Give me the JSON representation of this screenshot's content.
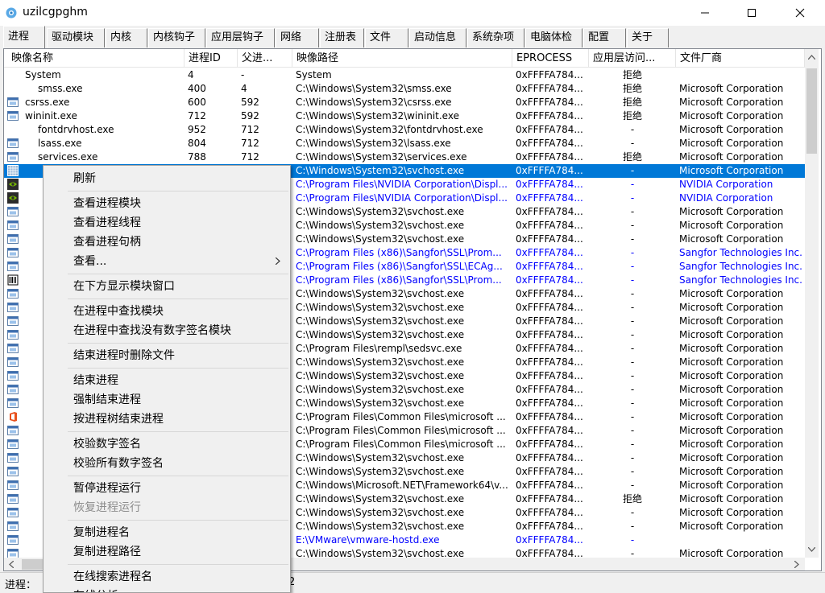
{
  "window": {
    "title": "uzilcgpghm"
  },
  "tabs": [
    "进程",
    "驱动模块",
    "内核",
    "内核钩子",
    "应用层钩子",
    "网络",
    "注册表",
    "文件",
    "启动信息",
    "系统杂项",
    "电脑体检",
    "配置",
    "关于"
  ],
  "columns": [
    "映像名称",
    "进程ID",
    "父进...",
    "映像路径",
    "EPROCESS",
    "应用层访问...",
    "文件厂商"
  ],
  "rows": [
    {
      "name": "System",
      "pid": "4",
      "ppid": "-",
      "path": "System",
      "eprocess": "0xFFFFA784...",
      "access": "拒绝",
      "vendor": "",
      "icon": "none",
      "indent": 1,
      "blue": false,
      "sel": false
    },
    {
      "name": "smss.exe",
      "pid": "400",
      "ppid": "4",
      "path": "C:\\Windows\\System32\\smss.exe",
      "eprocess": "0xFFFFA784...",
      "access": "拒绝",
      "vendor": "Microsoft Corporation",
      "icon": "none",
      "indent": 2,
      "blue": false,
      "sel": false
    },
    {
      "name": "csrss.exe",
      "pid": "600",
      "ppid": "592",
      "path": "C:\\Windows\\System32\\csrss.exe",
      "eprocess": "0xFFFFA784...",
      "access": "拒绝",
      "vendor": "Microsoft Corporation",
      "icon": "win",
      "indent": 0,
      "blue": false,
      "sel": false
    },
    {
      "name": "wininit.exe",
      "pid": "712",
      "ppid": "592",
      "path": "C:\\Windows\\System32\\wininit.exe",
      "eprocess": "0xFFFFA784...",
      "access": "拒绝",
      "vendor": "Microsoft Corporation",
      "icon": "win",
      "indent": 0,
      "blue": false,
      "sel": false
    },
    {
      "name": "fontdrvhost.exe",
      "pid": "952",
      "ppid": "712",
      "path": "C:\\Windows\\System32\\fontdrvhost.exe",
      "eprocess": "0xFFFFA784...",
      "access": "-",
      "vendor": "Microsoft Corporation",
      "icon": "none",
      "indent": 2,
      "blue": false,
      "sel": false
    },
    {
      "name": "lsass.exe",
      "pid": "804",
      "ppid": "712",
      "path": "C:\\Windows\\System32\\lsass.exe",
      "eprocess": "0xFFFFA784...",
      "access": "-",
      "vendor": "Microsoft Corporation",
      "icon": "win",
      "indent": 2,
      "blue": false,
      "sel": false
    },
    {
      "name": "services.exe",
      "pid": "788",
      "ppid": "712",
      "path": "C:\\Windows\\System32\\services.exe",
      "eprocess": "0xFFFFA784...",
      "access": "拒绝",
      "vendor": "Microsoft Corporation",
      "icon": "win",
      "indent": 2,
      "blue": false,
      "sel": false
    },
    {
      "name": "",
      "pid": "",
      "ppid": "",
      "path": "C:\\Windows\\System32\\svchost.exe",
      "eprocess": "0xFFFFA784...",
      "access": "-",
      "vendor": "Microsoft Corporation",
      "icon": "grid",
      "indent": 0,
      "blue": false,
      "sel": true
    },
    {
      "name": "",
      "pid": "",
      "ppid": "",
      "path": "C:\\Program Files\\NVIDIA Corporation\\Displ...",
      "eprocess": "0xFFFFA784...",
      "access": "-",
      "vendor": "NVIDIA Corporation",
      "icon": "nvidia",
      "indent": 0,
      "blue": true,
      "sel": false
    },
    {
      "name": "",
      "pid": "",
      "ppid": "",
      "path": "C:\\Program Files\\NVIDIA Corporation\\Displ...",
      "eprocess": "0xFFFFA784...",
      "access": "-",
      "vendor": "NVIDIA Corporation",
      "icon": "nvidia",
      "indent": 0,
      "blue": true,
      "sel": false
    },
    {
      "name": "",
      "pid": "",
      "ppid": "",
      "path": "C:\\Windows\\System32\\svchost.exe",
      "eprocess": "0xFFFFA784...",
      "access": "-",
      "vendor": "Microsoft Corporation",
      "icon": "win",
      "indent": 0,
      "blue": false,
      "sel": false
    },
    {
      "name": "",
      "pid": "",
      "ppid": "",
      "path": "C:\\Windows\\System32\\svchost.exe",
      "eprocess": "0xFFFFA784...",
      "access": "-",
      "vendor": "Microsoft Corporation",
      "icon": "win",
      "indent": 0,
      "blue": false,
      "sel": false
    },
    {
      "name": "",
      "pid": "",
      "ppid": "",
      "path": "C:\\Windows\\System32\\svchost.exe",
      "eprocess": "0xFFFFA784...",
      "access": "-",
      "vendor": "Microsoft Corporation",
      "icon": "win",
      "indent": 0,
      "blue": false,
      "sel": false
    },
    {
      "name": "",
      "pid": "",
      "ppid": "",
      "path": "C:\\Program Files (x86)\\Sangfor\\SSL\\Prom...",
      "eprocess": "0xFFFFA784...",
      "access": "-",
      "vendor": "Sangfor Technologies Inc.",
      "icon": "win",
      "indent": 0,
      "blue": true,
      "sel": false
    },
    {
      "name": "",
      "pid": "",
      "ppid": "",
      "path": "C:\\Program Files (x86)\\Sangfor\\SSL\\ECAg...",
      "eprocess": "0xFFFFA784...",
      "access": "-",
      "vendor": "Sangfor Technologies Inc.",
      "icon": "win",
      "indent": 0,
      "blue": true,
      "sel": false
    },
    {
      "name": "",
      "pid": "",
      "ppid": "",
      "path": "C:\\Program Files (x86)\\Sangfor\\SSL\\Prom...",
      "eprocess": "0xFFFFA784...",
      "access": "-",
      "vendor": "Sangfor Technologies Inc.",
      "icon": "barcode",
      "indent": 0,
      "blue": true,
      "sel": false
    },
    {
      "name": "",
      "pid": "",
      "ppid": "",
      "path": "C:\\Windows\\System32\\svchost.exe",
      "eprocess": "0xFFFFA784...",
      "access": "-",
      "vendor": "Microsoft Corporation",
      "icon": "win",
      "indent": 0,
      "blue": false,
      "sel": false
    },
    {
      "name": "",
      "pid": "",
      "ppid": "",
      "path": "C:\\Windows\\System32\\svchost.exe",
      "eprocess": "0xFFFFA784...",
      "access": "-",
      "vendor": "Microsoft Corporation",
      "icon": "win",
      "indent": 0,
      "blue": false,
      "sel": false
    },
    {
      "name": "",
      "pid": "",
      "ppid": "",
      "path": "C:\\Windows\\System32\\svchost.exe",
      "eprocess": "0xFFFFA784...",
      "access": "-",
      "vendor": "Microsoft Corporation",
      "icon": "win",
      "indent": 0,
      "blue": false,
      "sel": false
    },
    {
      "name": "",
      "pid": "",
      "ppid": "",
      "path": "C:\\Windows\\System32\\svchost.exe",
      "eprocess": "0xFFFFA784...",
      "access": "-",
      "vendor": "Microsoft Corporation",
      "icon": "win",
      "indent": 0,
      "blue": false,
      "sel": false
    },
    {
      "name": "",
      "pid": "",
      "ppid": "",
      "path": "C:\\Program Files\\rempl\\sedsvc.exe",
      "eprocess": "0xFFFFA784...",
      "access": "-",
      "vendor": "Microsoft Corporation",
      "icon": "win",
      "indent": 0,
      "blue": false,
      "sel": false
    },
    {
      "name": "",
      "pid": "",
      "ppid": "",
      "path": "C:\\Windows\\System32\\svchost.exe",
      "eprocess": "0xFFFFA784...",
      "access": "-",
      "vendor": "Microsoft Corporation",
      "icon": "win",
      "indent": 0,
      "blue": false,
      "sel": false
    },
    {
      "name": "",
      "pid": "",
      "ppid": "",
      "path": "C:\\Windows\\System32\\svchost.exe",
      "eprocess": "0xFFFFA784...",
      "access": "-",
      "vendor": "Microsoft Corporation",
      "icon": "win",
      "indent": 0,
      "blue": false,
      "sel": false
    },
    {
      "name": "",
      "pid": "",
      "ppid": "",
      "path": "C:\\Windows\\System32\\svchost.exe",
      "eprocess": "0xFFFFA784...",
      "access": "-",
      "vendor": "Microsoft Corporation",
      "icon": "win",
      "indent": 0,
      "blue": false,
      "sel": false
    },
    {
      "name": "",
      "pid": "",
      "ppid": "",
      "path": "C:\\Windows\\System32\\svchost.exe",
      "eprocess": "0xFFFFA784...",
      "access": "-",
      "vendor": "Microsoft Corporation",
      "icon": "win",
      "indent": 0,
      "blue": false,
      "sel": false
    },
    {
      "name": "",
      "pid": "",
      "ppid": "",
      "path": "C:\\Program Files\\Common Files\\microsoft ...",
      "eprocess": "0xFFFFA784...",
      "access": "-",
      "vendor": "Microsoft Corporation",
      "icon": "office",
      "indent": 0,
      "blue": false,
      "sel": false
    },
    {
      "name": "",
      "pid": "",
      "ppid": "",
      "path": "C:\\Program Files\\Common Files\\microsoft ...",
      "eprocess": "0xFFFFA784...",
      "access": "-",
      "vendor": "Microsoft Corporation",
      "icon": "win",
      "indent": 0,
      "blue": false,
      "sel": false
    },
    {
      "name": "",
      "pid": "",
      "ppid": "",
      "path": "C:\\Program Files\\Common Files\\microsoft ...",
      "eprocess": "0xFFFFA784...",
      "access": "-",
      "vendor": "Microsoft Corporation",
      "icon": "win",
      "indent": 0,
      "blue": false,
      "sel": false
    },
    {
      "name": "",
      "pid": "",
      "ppid": "",
      "path": "C:\\Windows\\System32\\svchost.exe",
      "eprocess": "0xFFFFA784...",
      "access": "-",
      "vendor": "Microsoft Corporation",
      "icon": "win",
      "indent": 0,
      "blue": false,
      "sel": false
    },
    {
      "name": "",
      "pid": "",
      "ppid": "",
      "path": "C:\\Windows\\System32\\svchost.exe",
      "eprocess": "0xFFFFA784...",
      "access": "-",
      "vendor": "Microsoft Corporation",
      "icon": "win",
      "indent": 0,
      "blue": false,
      "sel": false
    },
    {
      "name": "",
      "pid": "",
      "ppid": "",
      "path": "C:\\Windows\\Microsoft.NET\\Framework64\\v...",
      "eprocess": "0xFFFFA784...",
      "access": "-",
      "vendor": "Microsoft Corporation",
      "icon": "win",
      "indent": 0,
      "blue": false,
      "sel": false
    },
    {
      "name": "",
      "pid": "",
      "ppid": "",
      "path": "C:\\Windows\\System32\\svchost.exe",
      "eprocess": "0xFFFFA784...",
      "access": "拒绝",
      "vendor": "Microsoft Corporation",
      "icon": "win",
      "indent": 0,
      "blue": false,
      "sel": false
    },
    {
      "name": "",
      "pid": "",
      "ppid": "",
      "path": "C:\\Windows\\System32\\svchost.exe",
      "eprocess": "0xFFFFA784...",
      "access": "-",
      "vendor": "Microsoft Corporation",
      "icon": "win",
      "indent": 0,
      "blue": false,
      "sel": false
    },
    {
      "name": "",
      "pid": "",
      "ppid": "",
      "path": "C:\\Windows\\System32\\svchost.exe",
      "eprocess": "0xFFFFA784...",
      "access": "-",
      "vendor": "Microsoft Corporation",
      "icon": "win",
      "indent": 0,
      "blue": false,
      "sel": false
    },
    {
      "name": "",
      "pid": "",
      "ppid": "",
      "path": "E:\\VMware\\vmware-hostd.exe",
      "eprocess": "0xFFFFA784...",
      "access": "-",
      "vendor": "",
      "icon": "win",
      "indent": 0,
      "blue": true,
      "sel": false
    },
    {
      "name": "",
      "pid": "",
      "ppid": "",
      "path": "C:\\Windows\\System32\\svchost.exe",
      "eprocess": "0xFFFFA784...",
      "access": "-",
      "vendor": "Microsoft Corporation",
      "icon": "win",
      "indent": 0,
      "blue": false,
      "sel": false
    }
  ],
  "context_menu": [
    {
      "label": "刷新"
    },
    {
      "sep": true
    },
    {
      "label": "查看进程模块"
    },
    {
      "label": "查看进程线程"
    },
    {
      "label": "查看进程句柄"
    },
    {
      "label": "查看...",
      "submenu": true
    },
    {
      "sep": true
    },
    {
      "label": "在下方显示模块窗口"
    },
    {
      "sep": true
    },
    {
      "label": "在进程中查找模块"
    },
    {
      "label": "在进程中查找没有数字签名模块"
    },
    {
      "sep": true
    },
    {
      "label": "结束进程时删除文件"
    },
    {
      "sep": true
    },
    {
      "label": "结束进程"
    },
    {
      "label": "强制结束进程"
    },
    {
      "label": "按进程树结束进程"
    },
    {
      "sep": true
    },
    {
      "label": "校验数字签名"
    },
    {
      "label": "校验所有数字签名"
    },
    {
      "sep": true
    },
    {
      "label": "暂停进程运行"
    },
    {
      "label": "恢复进程运行",
      "disabled": true
    },
    {
      "sep": true
    },
    {
      "label": "复制进程名"
    },
    {
      "label": "复制进程路径"
    },
    {
      "sep": true
    },
    {
      "label": "在线搜索进程名"
    },
    {
      "label": "在线分析"
    }
  ],
  "status": {
    "label": "进程：",
    "count_suffix": "2"
  },
  "colors": {
    "selection": "#0078d7",
    "blue_text": "#0000ff",
    "disabled_text": "#8d8d8d"
  }
}
